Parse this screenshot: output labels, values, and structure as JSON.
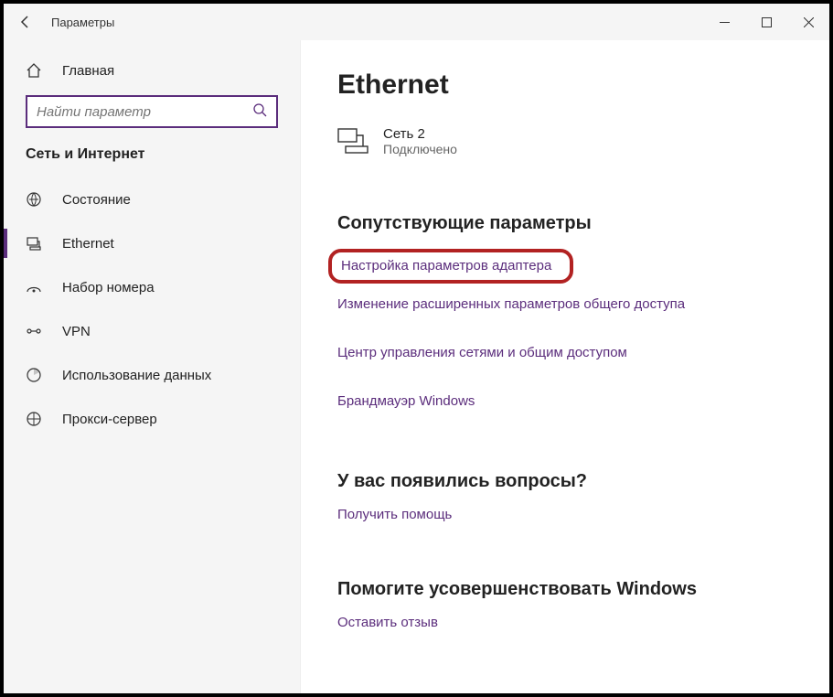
{
  "window": {
    "title": "Параметры"
  },
  "sidebar": {
    "home_label": "Главная",
    "search_placeholder": "Найти параметр",
    "section_title": "Сеть и Интернет",
    "items": [
      {
        "label": "Состояние"
      },
      {
        "label": "Ethernet"
      },
      {
        "label": "Набор номера"
      },
      {
        "label": "VPN"
      },
      {
        "label": "Использование данных"
      },
      {
        "label": "Прокси-сервер"
      }
    ]
  },
  "main": {
    "page_title": "Ethernet",
    "network": {
      "name": "Сеть 2",
      "status": "Подключено"
    },
    "related": {
      "title": "Сопутствующие параметры",
      "links": [
        "Настройка параметров адаптера",
        "Изменение расширенных параметров общего доступа",
        "Центр управления сетями и общим доступом",
        "Брандмауэр Windows"
      ]
    },
    "questions": {
      "title": "У вас появились вопросы?",
      "link": "Получить помощь"
    },
    "improve": {
      "title": "Помогите усовершенствовать Windows",
      "link": "Оставить отзыв"
    }
  }
}
